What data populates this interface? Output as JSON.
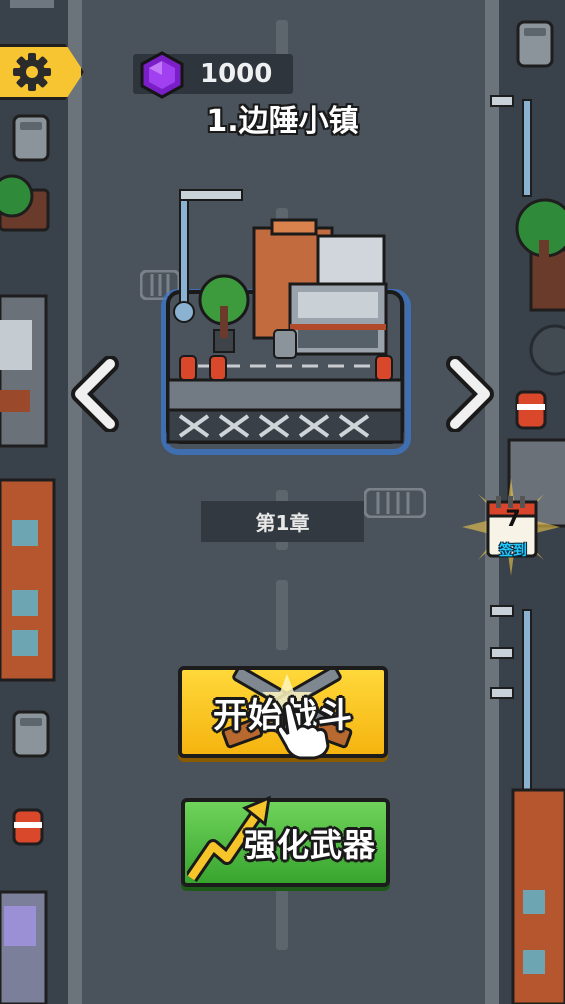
{
  "hud": {
    "gems": "1000",
    "gem_icon": "purple-gem-icon",
    "settings_icon": "gear-icon"
  },
  "level": {
    "title": "1.边陲小镇",
    "chapter": "第1章"
  },
  "nav": {
    "prev_icon": "chevron-left-icon",
    "next_icon": "chevron-right-icon"
  },
  "checkin": {
    "day": "7",
    "label": "签到",
    "icon": "calendar-icon"
  },
  "buttons": {
    "start": "开始战斗",
    "upgrade": "强化武器"
  },
  "colors": {
    "start_button": "#f5b40f",
    "upgrade_button": "#38a52f",
    "gem": "#8a2be2",
    "road": "#4a525b"
  }
}
